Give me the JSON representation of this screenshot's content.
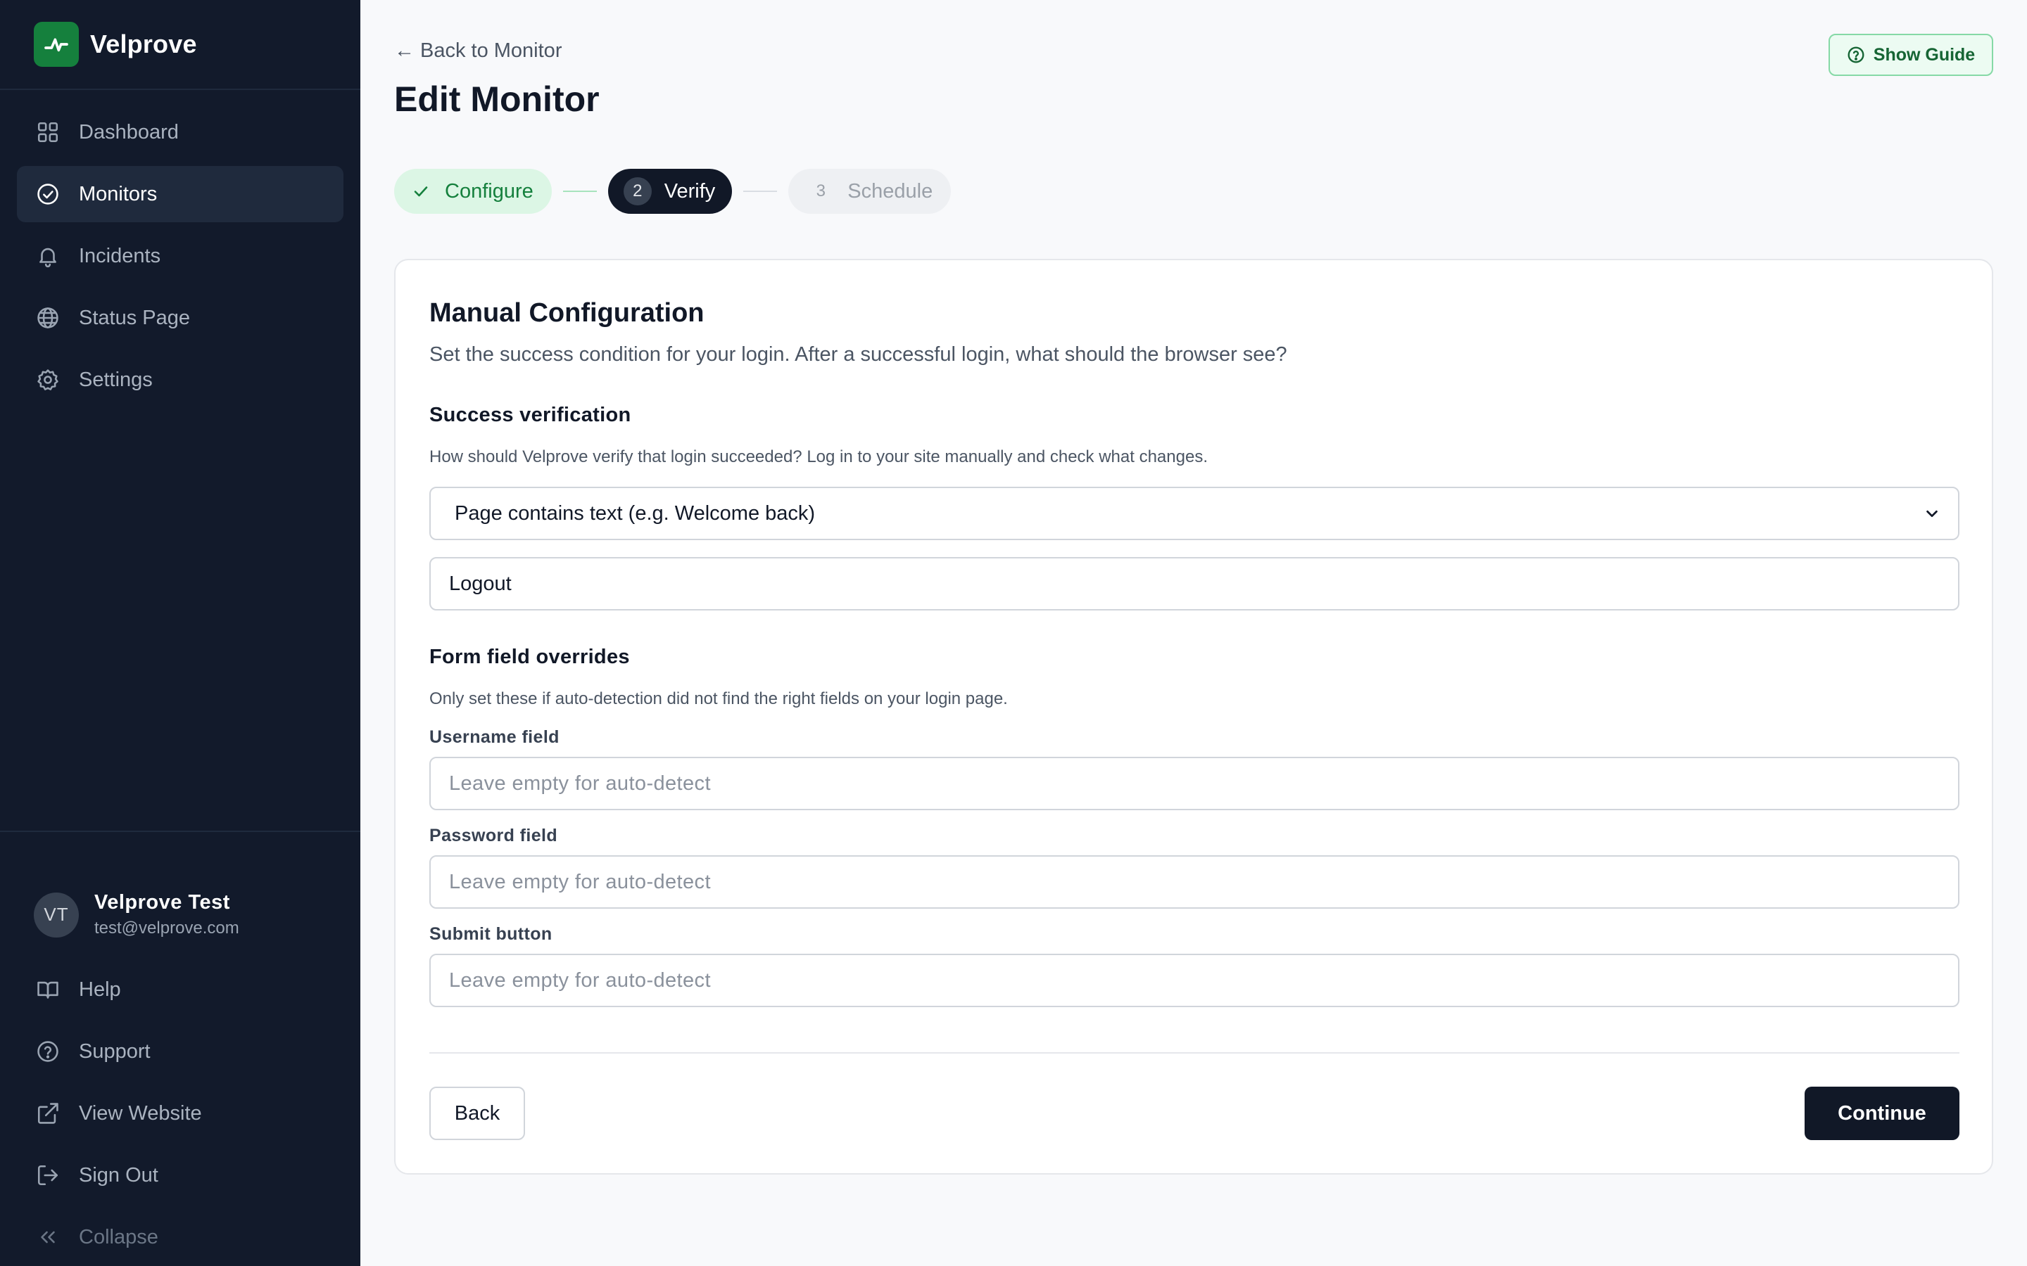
{
  "brand": {
    "name": "Velprove",
    "logo_icon": "activity-pulse-icon",
    "logo_color": "#15803d"
  },
  "sidebar": {
    "items": [
      {
        "label": "Dashboard",
        "icon": "grid-icon",
        "active": false
      },
      {
        "label": "Monitors",
        "icon": "check-circle-icon",
        "active": true
      },
      {
        "label": "Incidents",
        "icon": "bell-icon",
        "active": false
      },
      {
        "label": "Status Page",
        "icon": "globe-icon",
        "active": false
      },
      {
        "label": "Settings",
        "icon": "gear-icon",
        "active": false
      }
    ],
    "user": {
      "initials": "VT",
      "name": "Velprove Test",
      "email": "test@velprove.com"
    },
    "bottom_links": [
      {
        "label": "Help",
        "icon": "book-icon"
      },
      {
        "label": "Support",
        "icon": "question-circle-icon"
      },
      {
        "label": "View Website",
        "icon": "external-link-icon"
      },
      {
        "label": "Sign Out",
        "icon": "sign-out-icon"
      },
      {
        "label": "Collapse",
        "icon": "chevrons-left-icon"
      }
    ]
  },
  "header": {
    "back_link": "Back to Monitor",
    "back_arrow": "←",
    "title": "Edit Monitor",
    "guide_button": "Show Guide"
  },
  "stepper": {
    "steps": [
      {
        "number": "1",
        "label": "Configure",
        "state": "done"
      },
      {
        "number": "2",
        "label": "Verify",
        "state": "current"
      },
      {
        "number": "3",
        "label": "Schedule",
        "state": "upcoming"
      }
    ]
  },
  "card": {
    "title": "Manual Configuration",
    "subtitle": "Set the success condition for your login. After a successful login, what should the browser see?",
    "success": {
      "title": "Success verification",
      "description": "How should Velprove verify that login succeeded? Log in to your site manually and check what changes.",
      "select_value": "Page contains text (e.g. Welcome back)",
      "text_value": "Logout"
    },
    "overrides": {
      "title": "Form field overrides",
      "description": "Only set these if auto-detection did not find the right fields on your login page.",
      "username_label": "Username field",
      "username_placeholder": "Leave empty for auto-detect",
      "password_label": "Password field",
      "password_placeholder": "Leave empty for auto-detect",
      "submit_label": "Submit button",
      "submit_placeholder": "Leave empty for auto-detect"
    },
    "back_button": "Back",
    "continue_button": "Continue"
  },
  "colors": {
    "sidebar_bg": "#121a2b",
    "accent_green": "#15803d",
    "primary_dark": "#111827"
  }
}
